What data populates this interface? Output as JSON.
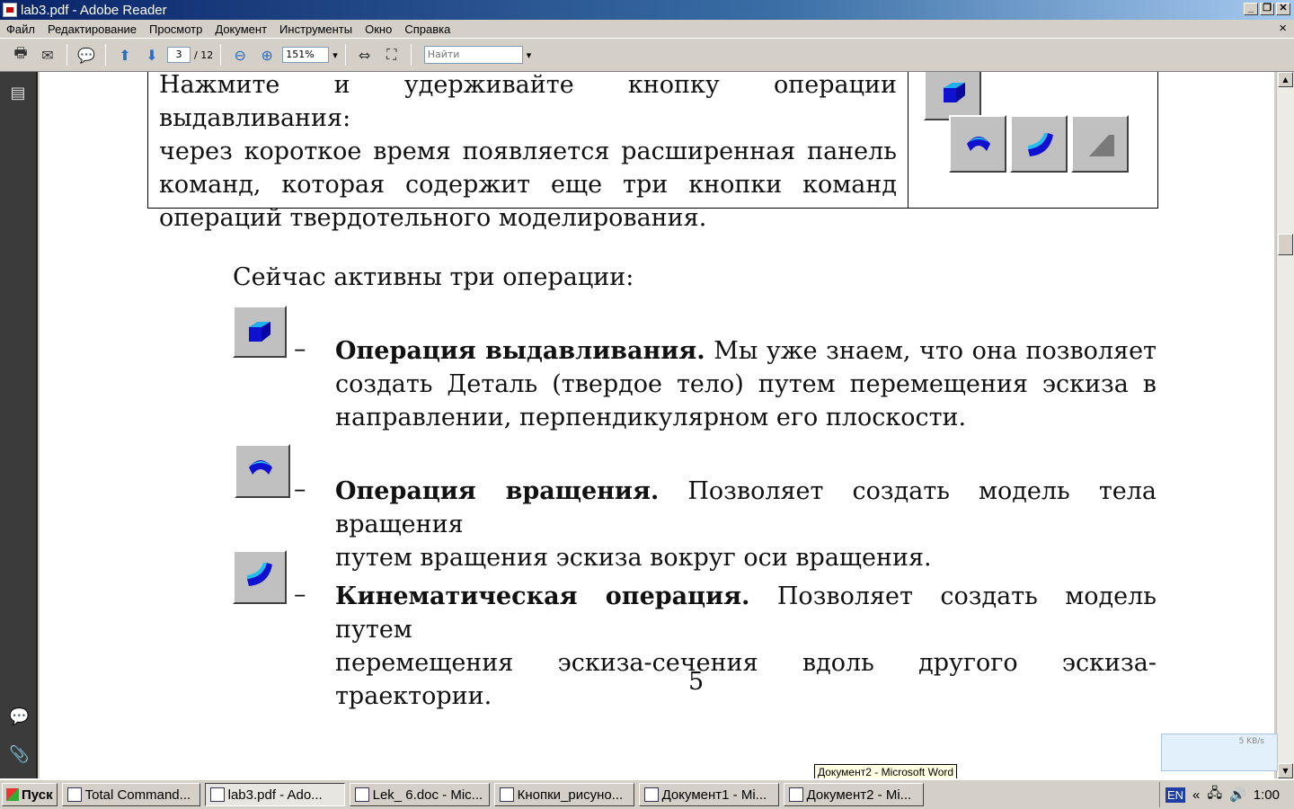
{
  "window": {
    "title": "lab3.pdf - Adobe Reader"
  },
  "menu": [
    "Файл",
    "Редактирование",
    "Просмотр",
    "Документ",
    "Инструменты",
    "Окно",
    "Справка"
  ],
  "toolbar": {
    "page_current": "3",
    "page_total": "/ 12",
    "zoom": "151%",
    "find_placeholder": "Найти"
  },
  "document": {
    "table_lines": [
      "Нажмите и удерживайте кнопку операции выдавливания:",
      "через короткое время появляется расширенная панель",
      "команд, которая содержит еще три кнопки команд",
      "операций твердотельного моделирования."
    ],
    "intro": "Сейчас активны три операции:",
    "items": [
      {
        "title": "Операция выдавливания.",
        "line1": "Мы уже знаем, что она позволяет",
        "line2": "создать Деталь (твердое тело) путем перемещения эскиза в",
        "line3": "направлении, перпендикулярном его плоскости."
      },
      {
        "title": "Операция вращения.",
        "line1": "Позволяет создать модель тела вращения",
        "line2": "путем вращения эскиза вокруг оси вращения."
      },
      {
        "title": "Кинематическая операция.",
        "line1": "Позволяет создать модель путем",
        "line2": "перемещения эскиза-сечения вдоль другого эскиза-траектории."
      }
    ],
    "dash": "–",
    "page_number": "5"
  },
  "taskbar": {
    "start": "Пуск",
    "tasks": [
      "Total Command...",
      "lab3.pdf - Ado...",
      "Lek_ 6.doc - Mic...",
      "Кнопки_рисуно...",
      "Документ1 - Mi...",
      "Документ2 - Mi..."
    ],
    "lang": "EN",
    "tray_arrows": "«",
    "clock": "1:00"
  },
  "tooltip": "Документ2 - Microsoft Word",
  "network": {
    "speed": "5 KB/s"
  }
}
